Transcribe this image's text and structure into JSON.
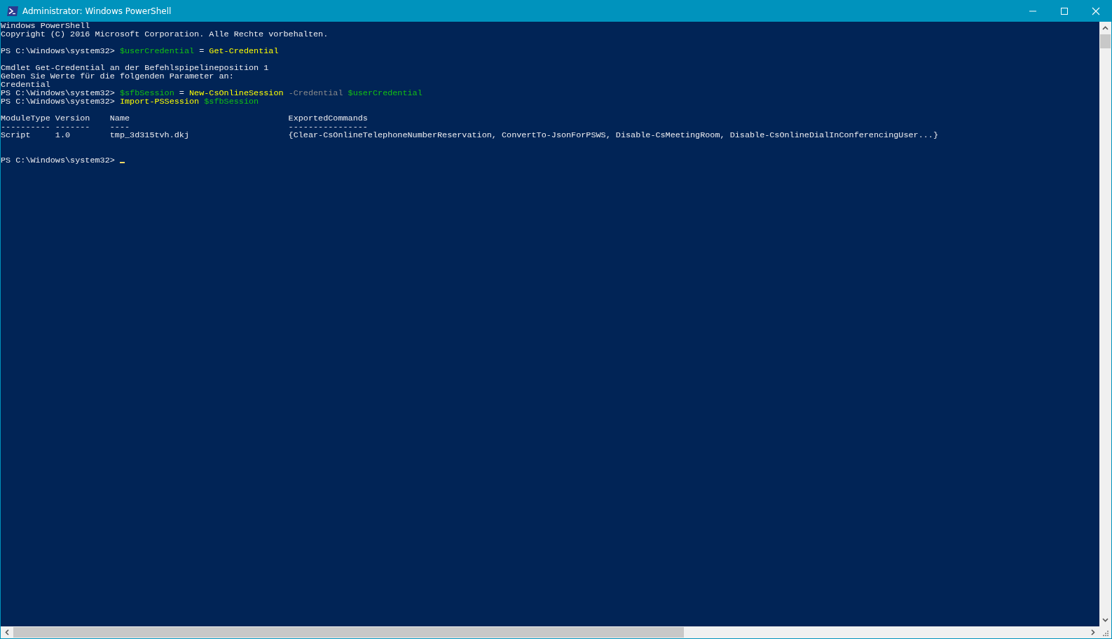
{
  "window": {
    "title": "Administrator: Windows PowerShell"
  },
  "console": {
    "blocks": [
      [
        {
          "cursor": false,
          "segments": [
            {
              "kind": "output",
              "text": "Windows PowerShell"
            }
          ]
        },
        {
          "cursor": false,
          "segments": [
            {
              "kind": "output",
              "text": "Copyright (C) 2016 Microsoft Corporation. Alle Rechte vorbehalten."
            }
          ]
        }
      ],
      [
        {
          "cursor": false,
          "segments": [
            {
              "kind": "output",
              "text": "PS C:\\Windows\\system32> "
            },
            {
              "kind": "variable",
              "text": "$userCredential"
            },
            {
              "kind": "output",
              "text": " = "
            },
            {
              "kind": "command",
              "text": "Get-Credential"
            }
          ]
        }
      ],
      [
        {
          "cursor": false,
          "segments": [
            {
              "kind": "output",
              "text": "Cmdlet Get-Credential an der Befehlspipelineposition 1"
            }
          ]
        },
        {
          "cursor": false,
          "segments": [
            {
              "kind": "output",
              "text": "Geben Sie Werte für die folgenden Parameter an:"
            }
          ]
        },
        {
          "cursor": false,
          "segments": [
            {
              "kind": "output",
              "text": "Credential"
            }
          ]
        },
        {
          "cursor": false,
          "segments": [
            {
              "kind": "output",
              "text": "PS C:\\Windows\\system32> "
            },
            {
              "kind": "variable",
              "text": "$sfbSession"
            },
            {
              "kind": "output",
              "text": " = "
            },
            {
              "kind": "command",
              "text": "New-CsOnlineSession"
            },
            {
              "kind": "parameter",
              "text": " -Credential"
            },
            {
              "kind": "variable",
              "text": " $userCredential"
            }
          ]
        },
        {
          "cursor": false,
          "segments": [
            {
              "kind": "output",
              "text": "PS C:\\Windows\\system32> "
            },
            {
              "kind": "command",
              "text": "Import-PSSession"
            },
            {
              "kind": "variable",
              "text": " $sfbSession"
            }
          ]
        }
      ],
      [
        {
          "cursor": false,
          "segments": [
            {
              "kind": "output",
              "text": "ModuleType Version    Name                                ExportedCommands"
            }
          ]
        },
        {
          "cursor": false,
          "segments": [
            {
              "kind": "output",
              "text": "---------- -------    ----                                ----------------"
            }
          ]
        },
        {
          "cursor": false,
          "segments": [
            {
              "kind": "output",
              "text": "Script     1.0        tmp_3d315tvh.dkj                    {Clear-CsOnlineTelephoneNumberReservation, ConvertTo-JsonForPSWS, Disable-CsMeetingRoom, Disable-CsOnlineDialInConferencingUser...}"
            }
          ]
        }
      ],
      [
        {
          "cursor": true,
          "segments": [
            {
              "kind": "output",
              "text": "PS C:\\Windows\\system32> "
            }
          ]
        }
      ]
    ]
  }
}
